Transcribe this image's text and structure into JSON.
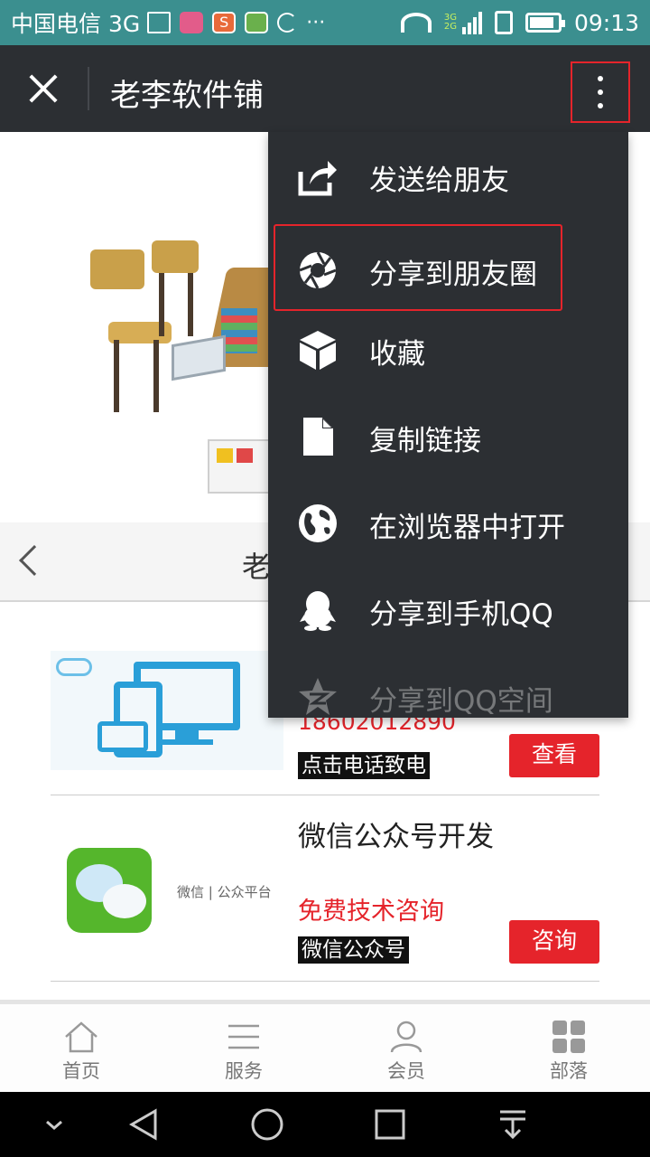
{
  "status_bar": {
    "carrier": "中国电信 3G",
    "more": "···",
    "network_badge_top": "3G",
    "network_badge_bottom": "2G",
    "time": "09:13",
    "battery_level": 0.85,
    "icons": [
      "image-icon",
      "game-icon",
      "sogou-icon",
      "app-icon",
      "sync-icon",
      "wifi-icon",
      "signal-icon",
      "sim-icon",
      "battery-icon"
    ]
  },
  "title_bar": {
    "title": "老李软件铺",
    "close_icon": "close-icon",
    "more_icon": "more-vertical-icon"
  },
  "slider": {
    "caption": "老"
  },
  "cards": [
    {
      "phone": "18602012890",
      "tag": "点击电话致电",
      "button": "查看"
    },
    {
      "title": "微信公众号开发",
      "brand": "微信 | 公众平台",
      "cta": "免费技术咨询",
      "tag": "微信公众号",
      "button": "咨询"
    }
  ],
  "menu": {
    "items": [
      {
        "label": "发送给朋友",
        "icon": "share-icon"
      },
      {
        "label": "分享到朋友圈",
        "icon": "moments-icon"
      },
      {
        "label": "收藏",
        "icon": "favorite-cube-icon"
      },
      {
        "label": "复制链接",
        "icon": "copy-document-icon"
      },
      {
        "label": "在浏览器中打开",
        "icon": "globe-icon"
      },
      {
        "label": "分享到手机QQ",
        "icon": "qq-icon"
      },
      {
        "label": "分享到QQ空间",
        "icon": "qzone-star-icon"
      }
    ]
  },
  "bottom_nav": {
    "items": [
      {
        "label": "首页",
        "icon": "home-icon"
      },
      {
        "label": "服务",
        "icon": "list-icon"
      },
      {
        "label": "会员",
        "icon": "user-icon"
      },
      {
        "label": "部落",
        "icon": "grid-icon"
      }
    ]
  },
  "colors": {
    "status_bar": "#3b8f8f",
    "title_bar": "#2c2f33",
    "accent_red": "#e5242b",
    "wechat_green": "#55b62c"
  }
}
